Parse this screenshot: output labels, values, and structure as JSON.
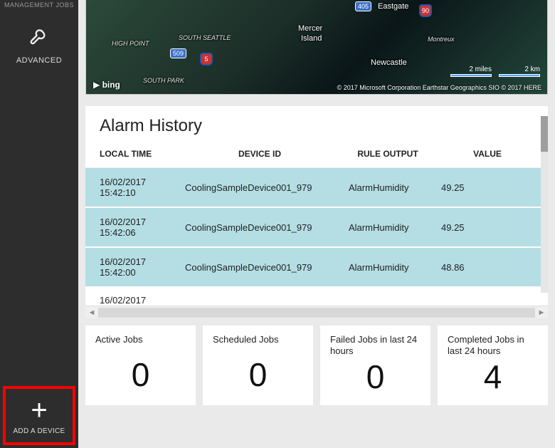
{
  "sidebar": {
    "top_partial": "MANAGEMENT JOBS",
    "advanced_label": "ADVANCED",
    "add_device_label": "ADD A DEVICE"
  },
  "map": {
    "labels": {
      "eastgate": "Eastgate",
      "mercer1": "Mercer",
      "mercer2": "Island",
      "south_seattle": "SOUTH SEATTLE",
      "high_point": "HIGH POINT",
      "south_park": "SOUTH PARK",
      "newcastle": "Newcastle",
      "montreux": "Montreux",
      "route509": "509",
      "route405": "405",
      "i5": "5",
      "i90": "90"
    },
    "bing": "bing",
    "scale_mi": "2 miles",
    "scale_km": "2 km",
    "attrib": "© 2017 Microsoft Corporation    Earthstar Geographics SIO    © 2017 HERE"
  },
  "alarm": {
    "title": "Alarm History",
    "columns": [
      "LOCAL TIME",
      "DEVICE ID",
      "RULE OUTPUT",
      "VALUE"
    ],
    "rows": [
      {
        "time1": "16/02/2017",
        "time2": "15:42:10",
        "device": "CoolingSampleDevice001_979",
        "rule": "AlarmHumidity",
        "value": "49.25"
      },
      {
        "time1": "16/02/2017",
        "time2": "15:42:06",
        "device": "CoolingSampleDevice001_979",
        "rule": "AlarmHumidity",
        "value": "49.25"
      },
      {
        "time1": "16/02/2017",
        "time2": "15:42:00",
        "device": "CoolingSampleDevice001_979",
        "rule": "AlarmHumidity",
        "value": "48.86"
      }
    ],
    "partial_time": "16/02/2017"
  },
  "tiles": [
    {
      "title": "Active Jobs",
      "value": "0"
    },
    {
      "title": "Scheduled Jobs",
      "value": "0"
    },
    {
      "title": "Failed Jobs in last 24 hours",
      "value": "0"
    },
    {
      "title": "Completed Jobs in last 24 hours",
      "value": "4"
    }
  ]
}
